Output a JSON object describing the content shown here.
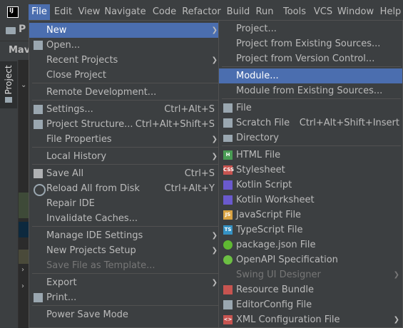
{
  "menubar": {
    "logo": "IJ",
    "items": [
      "File",
      "Edit",
      "View",
      "Navigate",
      "Code",
      "Refactor",
      "Build",
      "Run",
      "Tools",
      "VCS",
      "Window",
      "Help"
    ],
    "mnemonics": [
      "F",
      "E",
      "V",
      "N",
      "C",
      "R",
      "B",
      "u",
      "T",
      "S",
      "W",
      "H"
    ]
  },
  "toolbar": {
    "project_initial": "P"
  },
  "tabs": {
    "maven": "Mave"
  },
  "sidebar": {
    "project_tab": "Project"
  },
  "file_menu": {
    "items": [
      {
        "label": "New",
        "submenu": true
      },
      {
        "label": "Open..."
      },
      {
        "label": "Recent Projects",
        "submenu": true
      },
      {
        "label": "Close Project"
      },
      {
        "label": "Remote Development..."
      },
      {
        "label": "Settings...",
        "shortcut": "Ctrl+Alt+S"
      },
      {
        "label": "Project Structure...",
        "shortcut": "Ctrl+Alt+Shift+S"
      },
      {
        "label": "File Properties",
        "submenu": true
      },
      {
        "label": "Local History",
        "submenu": true
      },
      {
        "label": "Save All",
        "shortcut": "Ctrl+S"
      },
      {
        "label": "Reload All from Disk",
        "shortcut": "Ctrl+Alt+Y"
      },
      {
        "label": "Repair IDE"
      },
      {
        "label": "Invalidate Caches..."
      },
      {
        "label": "Manage IDE Settings",
        "submenu": true
      },
      {
        "label": "New Projects Setup",
        "submenu": true
      },
      {
        "label": "Save File as Template...",
        "disabled": true
      },
      {
        "label": "Export",
        "submenu": true
      },
      {
        "label": "Print..."
      },
      {
        "label": "Power Save Mode"
      }
    ]
  },
  "new_menu": {
    "items": [
      {
        "label": "Project..."
      },
      {
        "label": "Project from Existing Sources..."
      },
      {
        "label": "Project from Version Control..."
      },
      {
        "label": "Module...",
        "selected": true
      },
      {
        "label": "Module from Existing Sources..."
      },
      {
        "label": "File",
        "icon": "file-icon"
      },
      {
        "label": "Scratch File",
        "icon": "scratch-file-icon",
        "shortcut": "Ctrl+Alt+Shift+Insert"
      },
      {
        "label": "Directory",
        "icon": "folder-icon"
      },
      {
        "label": "HTML File",
        "icon": "html-icon",
        "badge": "H"
      },
      {
        "label": "Stylesheet",
        "icon": "css-icon",
        "badge": "CSS"
      },
      {
        "label": "Kotlin Script",
        "icon": "kotlin-icon"
      },
      {
        "label": "Kotlin Worksheet",
        "icon": "kotlin-icon"
      },
      {
        "label": "JavaScript File",
        "icon": "javascript-icon",
        "badge": "JS"
      },
      {
        "label": "TypeScript File",
        "icon": "typescript-icon",
        "badge": "TS"
      },
      {
        "label": "package.json File",
        "icon": "nodejs-icon"
      },
      {
        "label": "OpenAPI Specification",
        "icon": "openapi-icon"
      },
      {
        "label": "Swing UI Designer",
        "disabled": true,
        "submenu": true
      },
      {
        "label": "Resource Bundle",
        "icon": "resource-bundle-icon"
      },
      {
        "label": "EditorConfig File",
        "icon": "editorconfig-icon"
      },
      {
        "label": "XML Configuration File",
        "icon": "xml-icon",
        "badge": "<>",
        "submenu": true
      }
    ]
  },
  "colors": {
    "menu_bg": "#3c3f41",
    "selection": "#4b6eaf",
    "text": "#bbbbbb",
    "disabled_text": "#777777",
    "separator": "#515151"
  }
}
